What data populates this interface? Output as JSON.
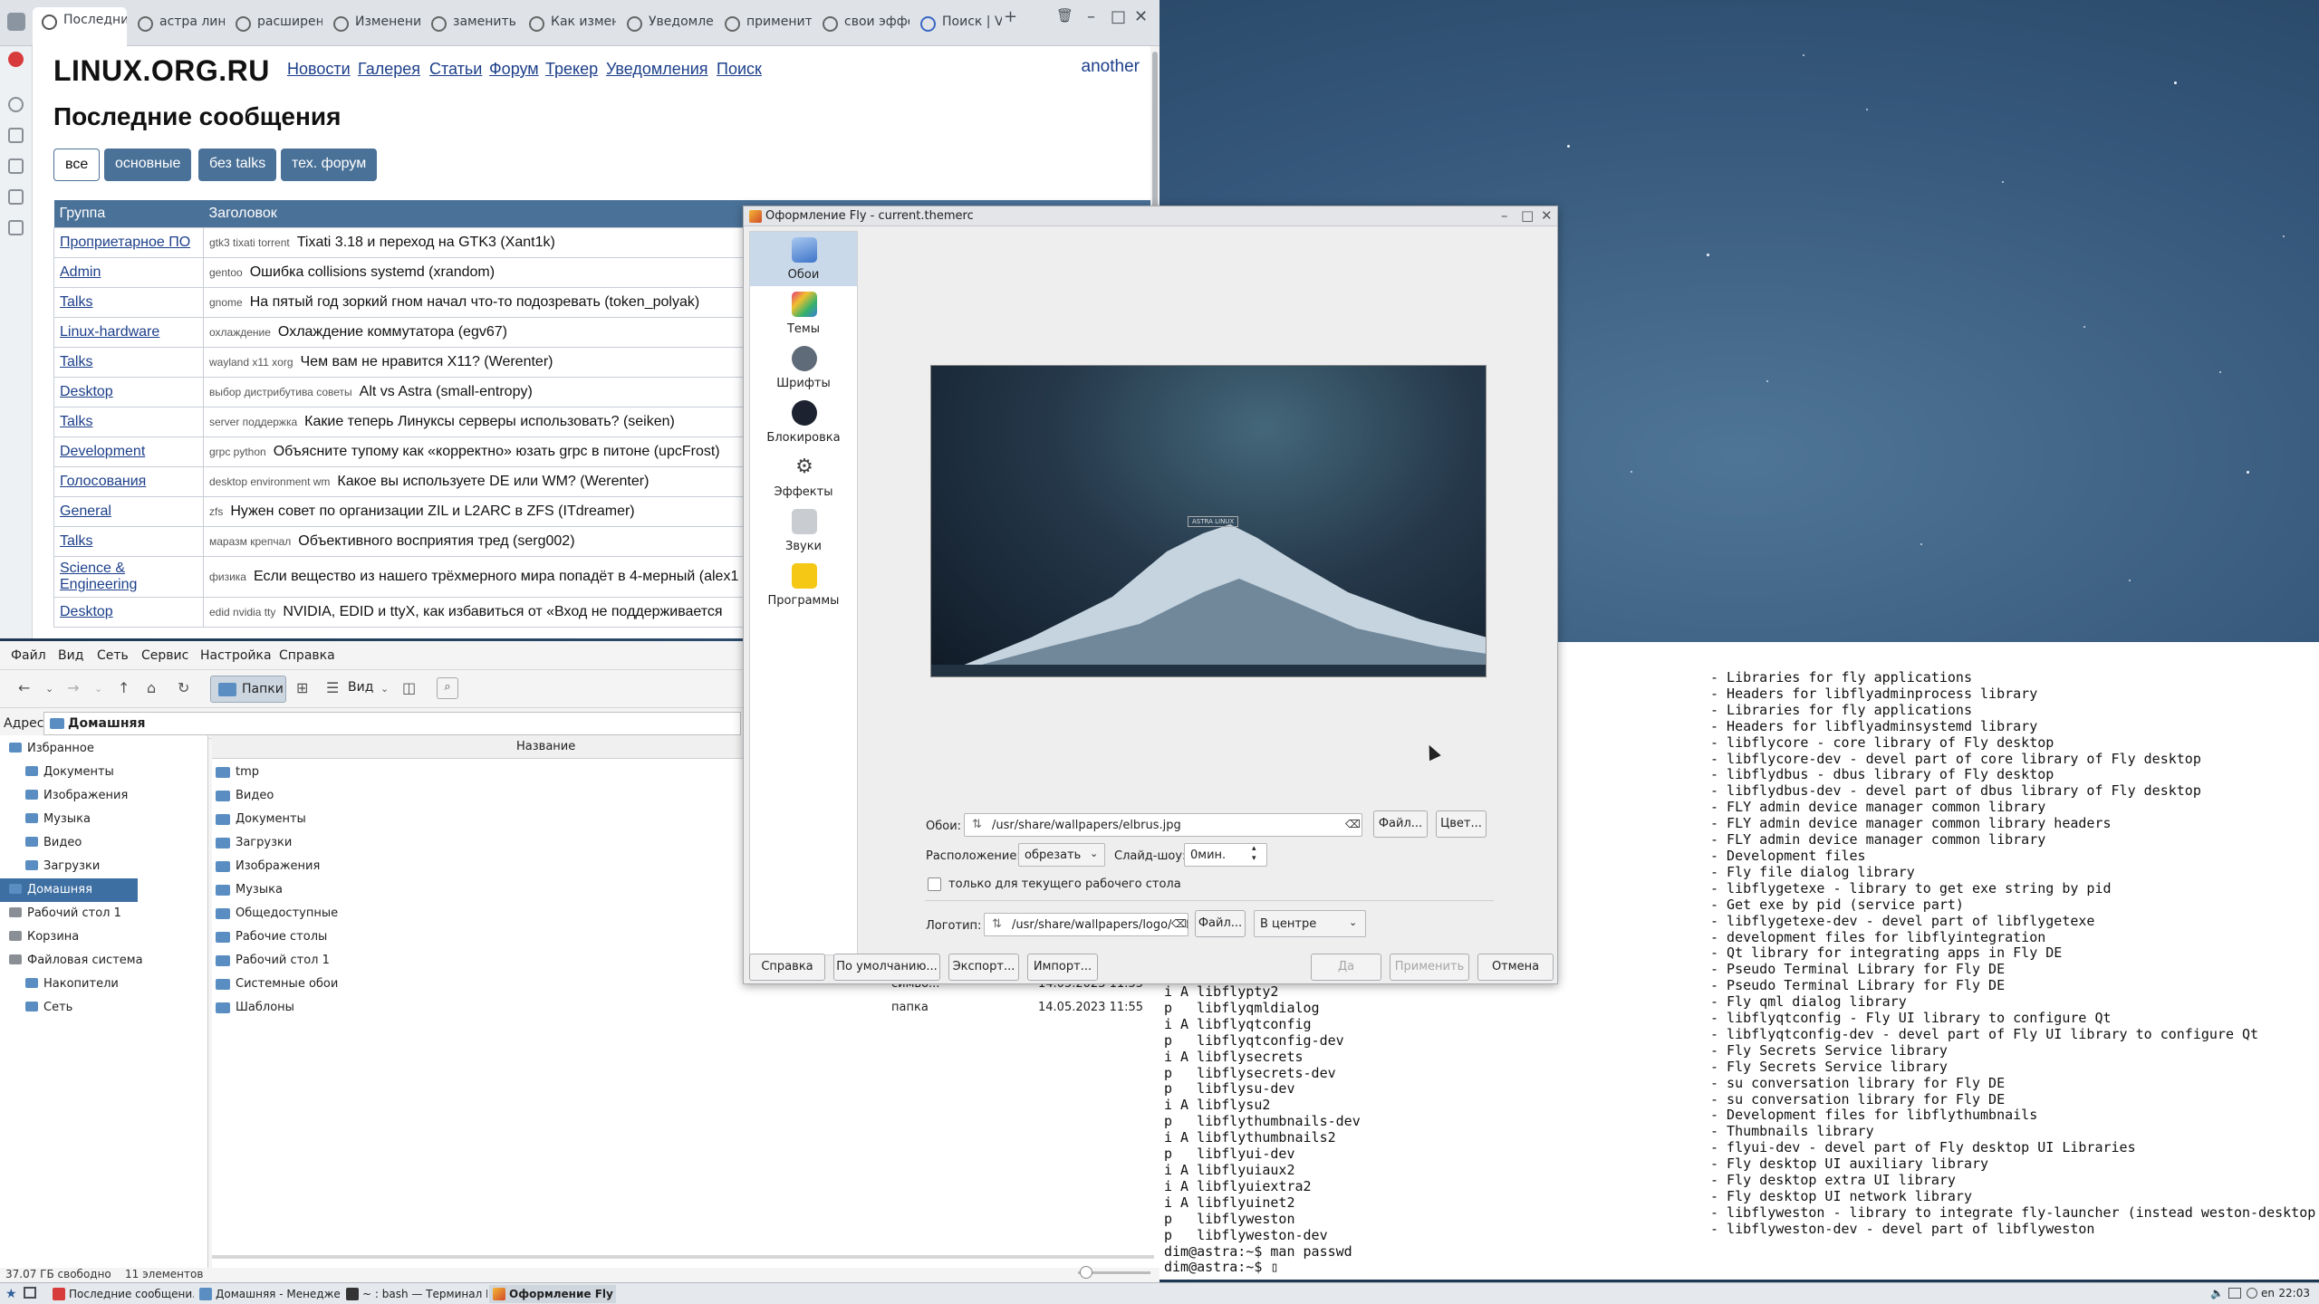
{
  "browser": {
    "tabs": [
      "Последние с",
      "астра лин...",
      "расширен...",
      "Изменени...",
      "заменить ...",
      "Как измен...",
      "Уведомле...",
      "применит...",
      "свои эффе...",
      "Поиск | Vi..."
    ],
    "new_tab": "+",
    "site": {
      "logo": "LINUX.ORG.RU",
      "nav": [
        "Новости",
        "Галерея",
        "Статьи",
        "Форум",
        "Трекер",
        "Уведомления",
        "Поиск"
      ],
      "user": "another",
      "heading": "Последние сообщения",
      "filters": [
        "все",
        "основные",
        "без talks",
        "тех. форум"
      ],
      "table_headers": [
        "Группа",
        "Заголовок"
      ],
      "rows": [
        {
          "group": "Проприетарное ПО",
          "tags": "gtk3  tixati  torrent",
          "title": "Tixati 3.18 и переход на GTK3 (Xant1k)"
        },
        {
          "group": "Admin",
          "tags": "gentoo",
          "title": "Ошибка collisions systemd (xrandom)"
        },
        {
          "group": "Talks",
          "tags": "gnome",
          "title": "На пятый год зоркий гном начал что-то подозревать (token_polyak)"
        },
        {
          "group": "Linux-hardware",
          "tags": "охлаждение",
          "title": "Охлаждение коммутатора (egv67)"
        },
        {
          "group": "Talks",
          "tags": "wayland  x11  xorg",
          "title": "Чем вам не нравится X11? (Werenter)"
        },
        {
          "group": "Desktop",
          "tags": "выбор дистрибутива  советы",
          "title": "Alt vs Astra (small-entropy)"
        },
        {
          "group": "Talks",
          "tags": "server  поддержка",
          "title": "Какие теперь Линуксы серверы использовать? (seiken)"
        },
        {
          "group": "Development",
          "tags": "grpc  python",
          "title": "Объясните тупому как «корректно» юзать grpc в питоне (upcFrost)"
        },
        {
          "group": "Голосования",
          "tags": "desktop environment  wm",
          "title": "Какое вы используете DE или WM? (Werenter)"
        },
        {
          "group": "General",
          "tags": "zfs",
          "title": "Нужен совет по организации ZIL и L2ARC в ZFS (ITdreamer)"
        },
        {
          "group": "Talks",
          "tags": "маразм крепчал",
          "title": "Объективного восприятия тред (serg002)"
        },
        {
          "group": "Science & Engineering",
          "tags": "физика",
          "title": "Если вещество из нашего трёхмерного мира попадёт в 4-мерный (alex1"
        },
        {
          "group": "Desktop",
          "tags": "edid  nvidia  tty",
          "title": "NVIDIA, EDID и ttyX, как избавиться от «Вход не поддерживается"
        }
      ]
    }
  },
  "filemanager": {
    "menu": [
      "Файл",
      "Вид",
      "Сеть",
      "Сервис",
      "Настройка",
      "Справка"
    ],
    "folders_btn": "Папки",
    "view_btn": "Вид",
    "address_label": "Адрес:",
    "address_value": "Домашняя",
    "tree": [
      {
        "label": "Избранное",
        "level": 0
      },
      {
        "label": "Документы",
        "level": 1
      },
      {
        "label": "Изображения",
        "level": 1
      },
      {
        "label": "Музыка",
        "level": 1
      },
      {
        "label": "Видео",
        "level": 1
      },
      {
        "label": "Загрузки",
        "level": 1
      },
      {
        "label": "Домашняя",
        "level": 0
      },
      {
        "label": "Рабочий стол 1",
        "level": 0
      },
      {
        "label": "Корзина",
        "level": 0
      },
      {
        "label": "Файловая система",
        "level": 0
      },
      {
        "label": "Накопители",
        "level": 1
      },
      {
        "label": "Сеть",
        "level": 1
      }
    ],
    "list_header": "Название",
    "files": [
      {
        "name": "tmp",
        "type": "",
        "date": ""
      },
      {
        "name": "Видео",
        "type": "",
        "date": ""
      },
      {
        "name": "Документы",
        "type": "",
        "date": ""
      },
      {
        "name": "Загрузки",
        "type": "",
        "date": ""
      },
      {
        "name": "Изображения",
        "type": "",
        "date": ""
      },
      {
        "name": "Музыка",
        "type": "",
        "date": ""
      },
      {
        "name": "Общедоступные",
        "type": "",
        "date": ""
      },
      {
        "name": "Рабочие столы",
        "type": "",
        "date": ""
      },
      {
        "name": "Рабочий стол 1",
        "type": "",
        "date": ""
      },
      {
        "name": "Системные обои",
        "type": "симво...",
        "date": "14.05.2023 11:55"
      },
      {
        "name": "Шаблоны",
        "type": "папка",
        "date": "14.05.2023 11:55"
      }
    ],
    "status_free": "37.07 ГБ свободно",
    "status_count": "11 элементов"
  },
  "terminal": {
    "left": "i A libflypty2\np   libflyqmldialog\ni A libflyqtconfig\np   libflyqtconfig-dev\ni A libflysecrets\np   libflysecrets-dev\np   libflysu-dev\ni A libflysu2\np   libflythumbnails-dev\ni A libflythumbnails2\np   libflyui-dev\ni A libflyuiaux2\ni A libflyuiextra2\ni A libflyuinet2\np   libflyweston\np   libflyweston-dev\ndim@astra:~$ man passwd\ndim@astra:~$ ▯",
    "right": "- Libraries for fly applications\n- Headers for libflyadminprocess library\n- Libraries for fly applications\n- Headers for libflyadminsystemd library\n- libflycore - core library of Fly desktop\n- libflycore-dev - devel part of core library of Fly desktop\n- libflydbus - dbus library of Fly desktop\n- libflydbus-dev - devel part of dbus library of Fly desktop\n- FLY admin device manager common library\n- FLY admin device manager common library headers\n- FLY admin device manager common library\n- Development files\n- Fly file dialog library\n- libflygetexe - library to get exe string by pid\n- Get exe by pid (service part)\n- libflygetexe-dev - devel part of libflygetexe\n- development files for libflyintegration\n- Qt library for integrating apps in Fly DE\n- Pseudo Terminal Library for Fly DE\n- Pseudo Terminal Library for Fly DE\n- Fly qml dialog library\n- libflyqtconfig - Fly UI library to configure Qt\n- libflyqtconfig-dev - devel part of Fly UI library to configure Qt\n- Fly Secrets Service library\n- Fly Secrets Service library\n- su conversation library for Fly DE\n- su conversation library for Fly DE\n- Development files for libflythumbnails\n- Thumbnails library\n- flyui-dev - devel part of Fly desktop UI Libraries\n- Fly desktop UI auxiliary library\n- Fly desktop extra UI library\n- Fly desktop UI network library\n- libflyweston - library to integrate fly-launcher (instead weston-desktop\n- libflyweston-dev - devel part of libflyweston"
  },
  "fly": {
    "title": "Оформление Fly - current.themerc",
    "nav": [
      "Обои",
      "Темы",
      "Шрифты",
      "Блокировка",
      "Эффекты",
      "Звуки",
      "Программы"
    ],
    "preview_badge": "ASTRA LINUX",
    "wallpaper_label": "Обои:",
    "wallpaper_path": "/usr/share/wallpapers/elbrus.jpg",
    "file_btn": "Файл...",
    "color_btn": "Цвет...",
    "position_label": "Расположение:",
    "position_value": "обрезать",
    "slideshow_label": "Слайд-шоу:",
    "slideshow_value": "0мин.",
    "only_current": "только для текущего рабочего стола",
    "logo_label": "Логотип:",
    "logo_path": "/usr/share/wallpapers/logo/astra_logo_red.png",
    "logo_file_btn": "Файл...",
    "logo_pos": "В центре",
    "buttons": {
      "help": "Справка",
      "defaults": "По умолчанию...",
      "export": "Экспорт...",
      "import": "Импорт...",
      "yes": "Да",
      "apply": "Применить",
      "cancel": "Отмена"
    }
  },
  "taskbar": {
    "tasks": [
      "Последние сообщени...",
      "Домашняя - Менедже...",
      "~ : bash — Терминал Fly",
      "Оформление Fly"
    ],
    "tray": "en",
    "clock": "22:03"
  }
}
